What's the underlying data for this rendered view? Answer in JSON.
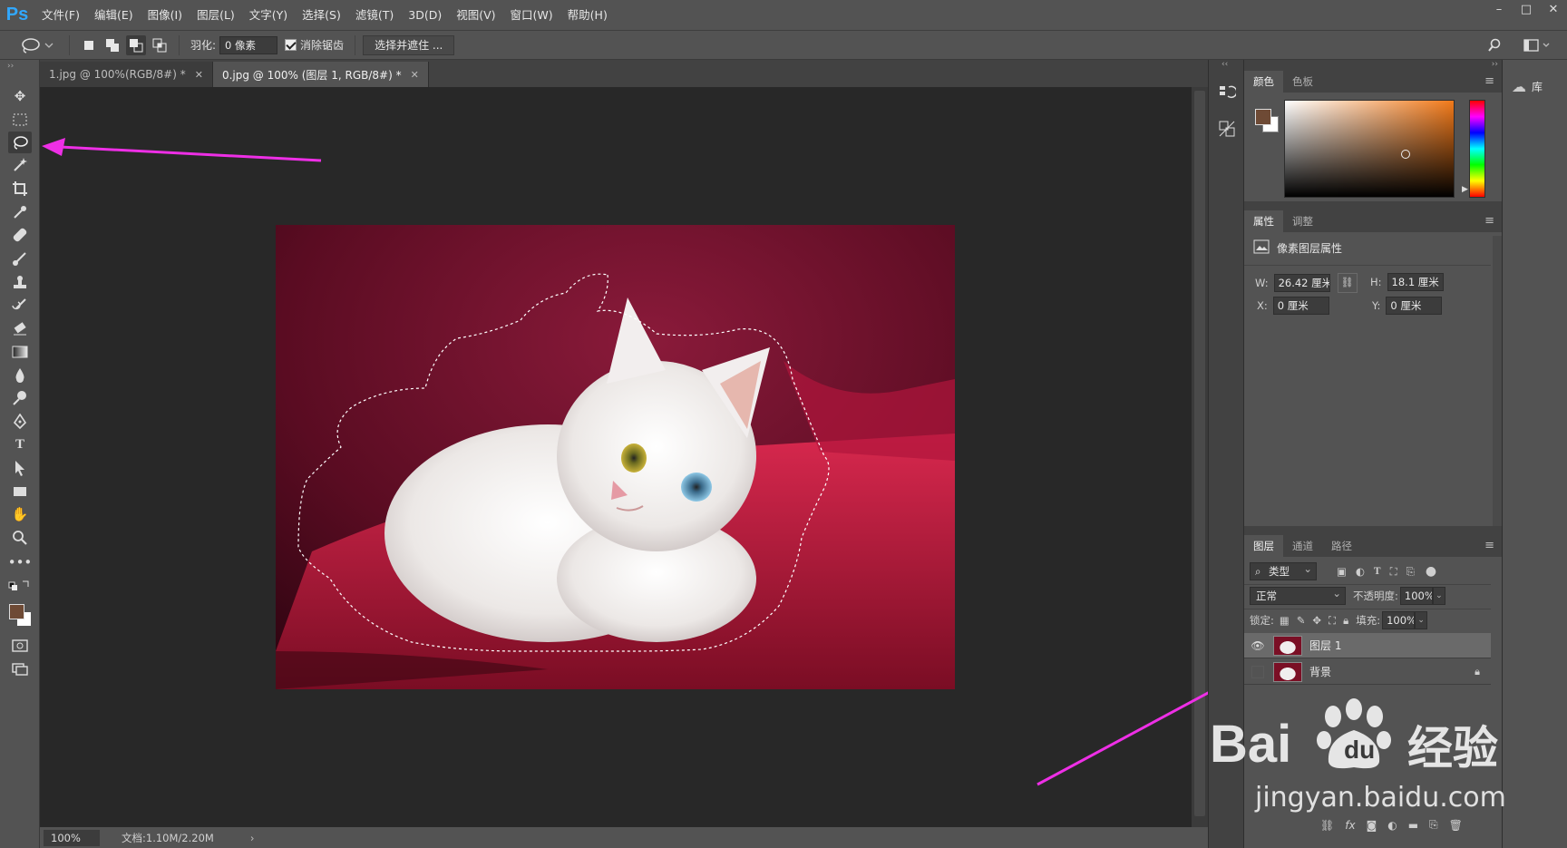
{
  "app": {
    "logo": "Ps"
  },
  "menu": [
    "文件(F)",
    "编辑(E)",
    "图像(I)",
    "图层(L)",
    "文字(Y)",
    "选择(S)",
    "滤镜(T)",
    "3D(D)",
    "视图(V)",
    "窗口(W)",
    "帮助(H)"
  ],
  "options": {
    "feather_label": "羽化:",
    "feather_value": "0 像素",
    "antialias_label": "消除锯齿",
    "select_mask_button": "选择并遮住 ..."
  },
  "tabs": [
    {
      "label": "1.jpg @ 100%(RGB/8#) *",
      "active": false
    },
    {
      "label": "0.jpg @ 100% (图层 1, RGB/8#) *",
      "active": true
    }
  ],
  "status": {
    "zoom": "100%",
    "doc_info": "文档:1.10M/2.20M"
  },
  "color_panel": {
    "tabs": [
      "颜色",
      "色板"
    ],
    "fg_color": "#6e4a35",
    "bg_color": "#ffffff"
  },
  "properties_panel": {
    "tabs": [
      "属性",
      "调整"
    ],
    "title": "像素图层属性",
    "w_label": "W:",
    "w_value": "26.42 厘米",
    "h_label": "H:",
    "h_value": "18.1 厘米",
    "x_label": "X:",
    "x_value": "0 厘米",
    "y_label": "Y:",
    "y_value": "0 厘米"
  },
  "layers_panel": {
    "tabs": [
      "图层",
      "通道",
      "路径"
    ],
    "filter_label": "类型",
    "blend_mode": "正常",
    "opacity_label": "不透明度:",
    "opacity_value": "100%",
    "lock_label": "锁定:",
    "fill_label": "填充:",
    "fill_value": "100%",
    "layers": [
      {
        "name": "图层 1",
        "visible": true,
        "selected": true,
        "locked": false
      },
      {
        "name": "背景",
        "visible": false,
        "selected": false,
        "locked": true
      }
    ]
  },
  "library_panel": {
    "label": "库"
  },
  "watermark": {
    "brand": "Bai",
    "cn": "经验",
    "url": "jingyan.baidu.com"
  },
  "accent_arrow_color": "#ee2fe6"
}
